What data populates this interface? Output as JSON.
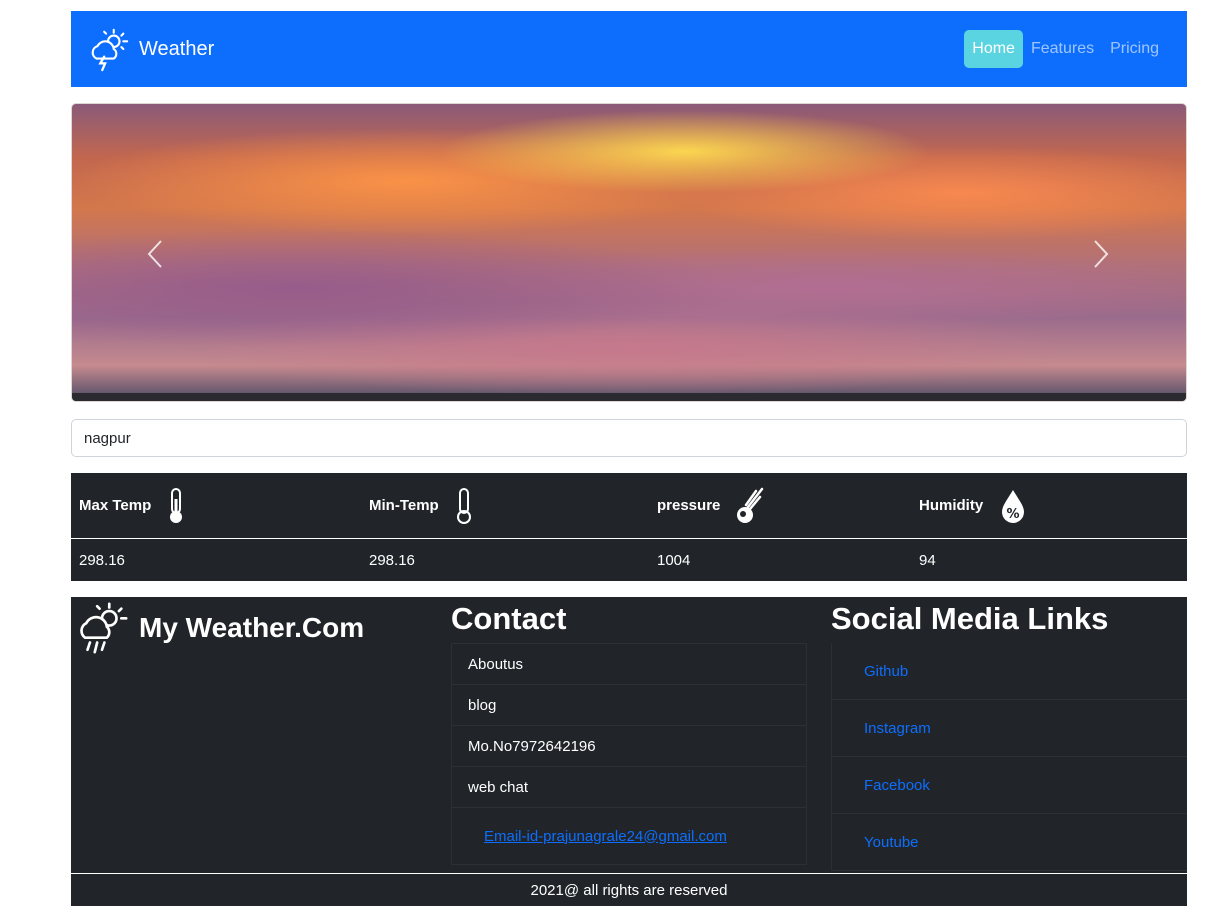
{
  "navbar": {
    "brand": "Weather",
    "brand_icon": "thunderstorm-sun-icon",
    "links": [
      {
        "label": "Home",
        "active": true
      },
      {
        "label": "Features",
        "active": false
      },
      {
        "label": "Pricing",
        "active": false
      }
    ],
    "color": "#0d6efd",
    "active_color": "#5ad4e0"
  },
  "carousel": {
    "prev_icon": "chevron-left-icon",
    "next_icon": "chevron-right-icon"
  },
  "search": {
    "value": "nagpur"
  },
  "weather_table": {
    "headers": [
      {
        "label": "Max Temp",
        "icon": "thermometer-icon"
      },
      {
        "label": "Min-Temp",
        "icon": "thermometer-icon"
      },
      {
        "label": "pressure",
        "icon": "meteor-icon"
      },
      {
        "label": "Humidity",
        "icon": "humidity-icon"
      }
    ],
    "values": [
      "298.16",
      "298.16",
      "1004",
      "94"
    ]
  },
  "footer": {
    "brand": "My Weather.Com",
    "contact": {
      "heading": "Contact",
      "items": [
        "Aboutus",
        "blog",
        "Mo.No7972642196",
        "web chat"
      ],
      "email": "Email-id-prajunagrale24@gmail.com"
    },
    "social": {
      "heading": "Social Media Links",
      "links": [
        "Github",
        "Instagram",
        "Facebook",
        "Youtube"
      ]
    },
    "copyright": "2021@ all rights are reserved"
  }
}
